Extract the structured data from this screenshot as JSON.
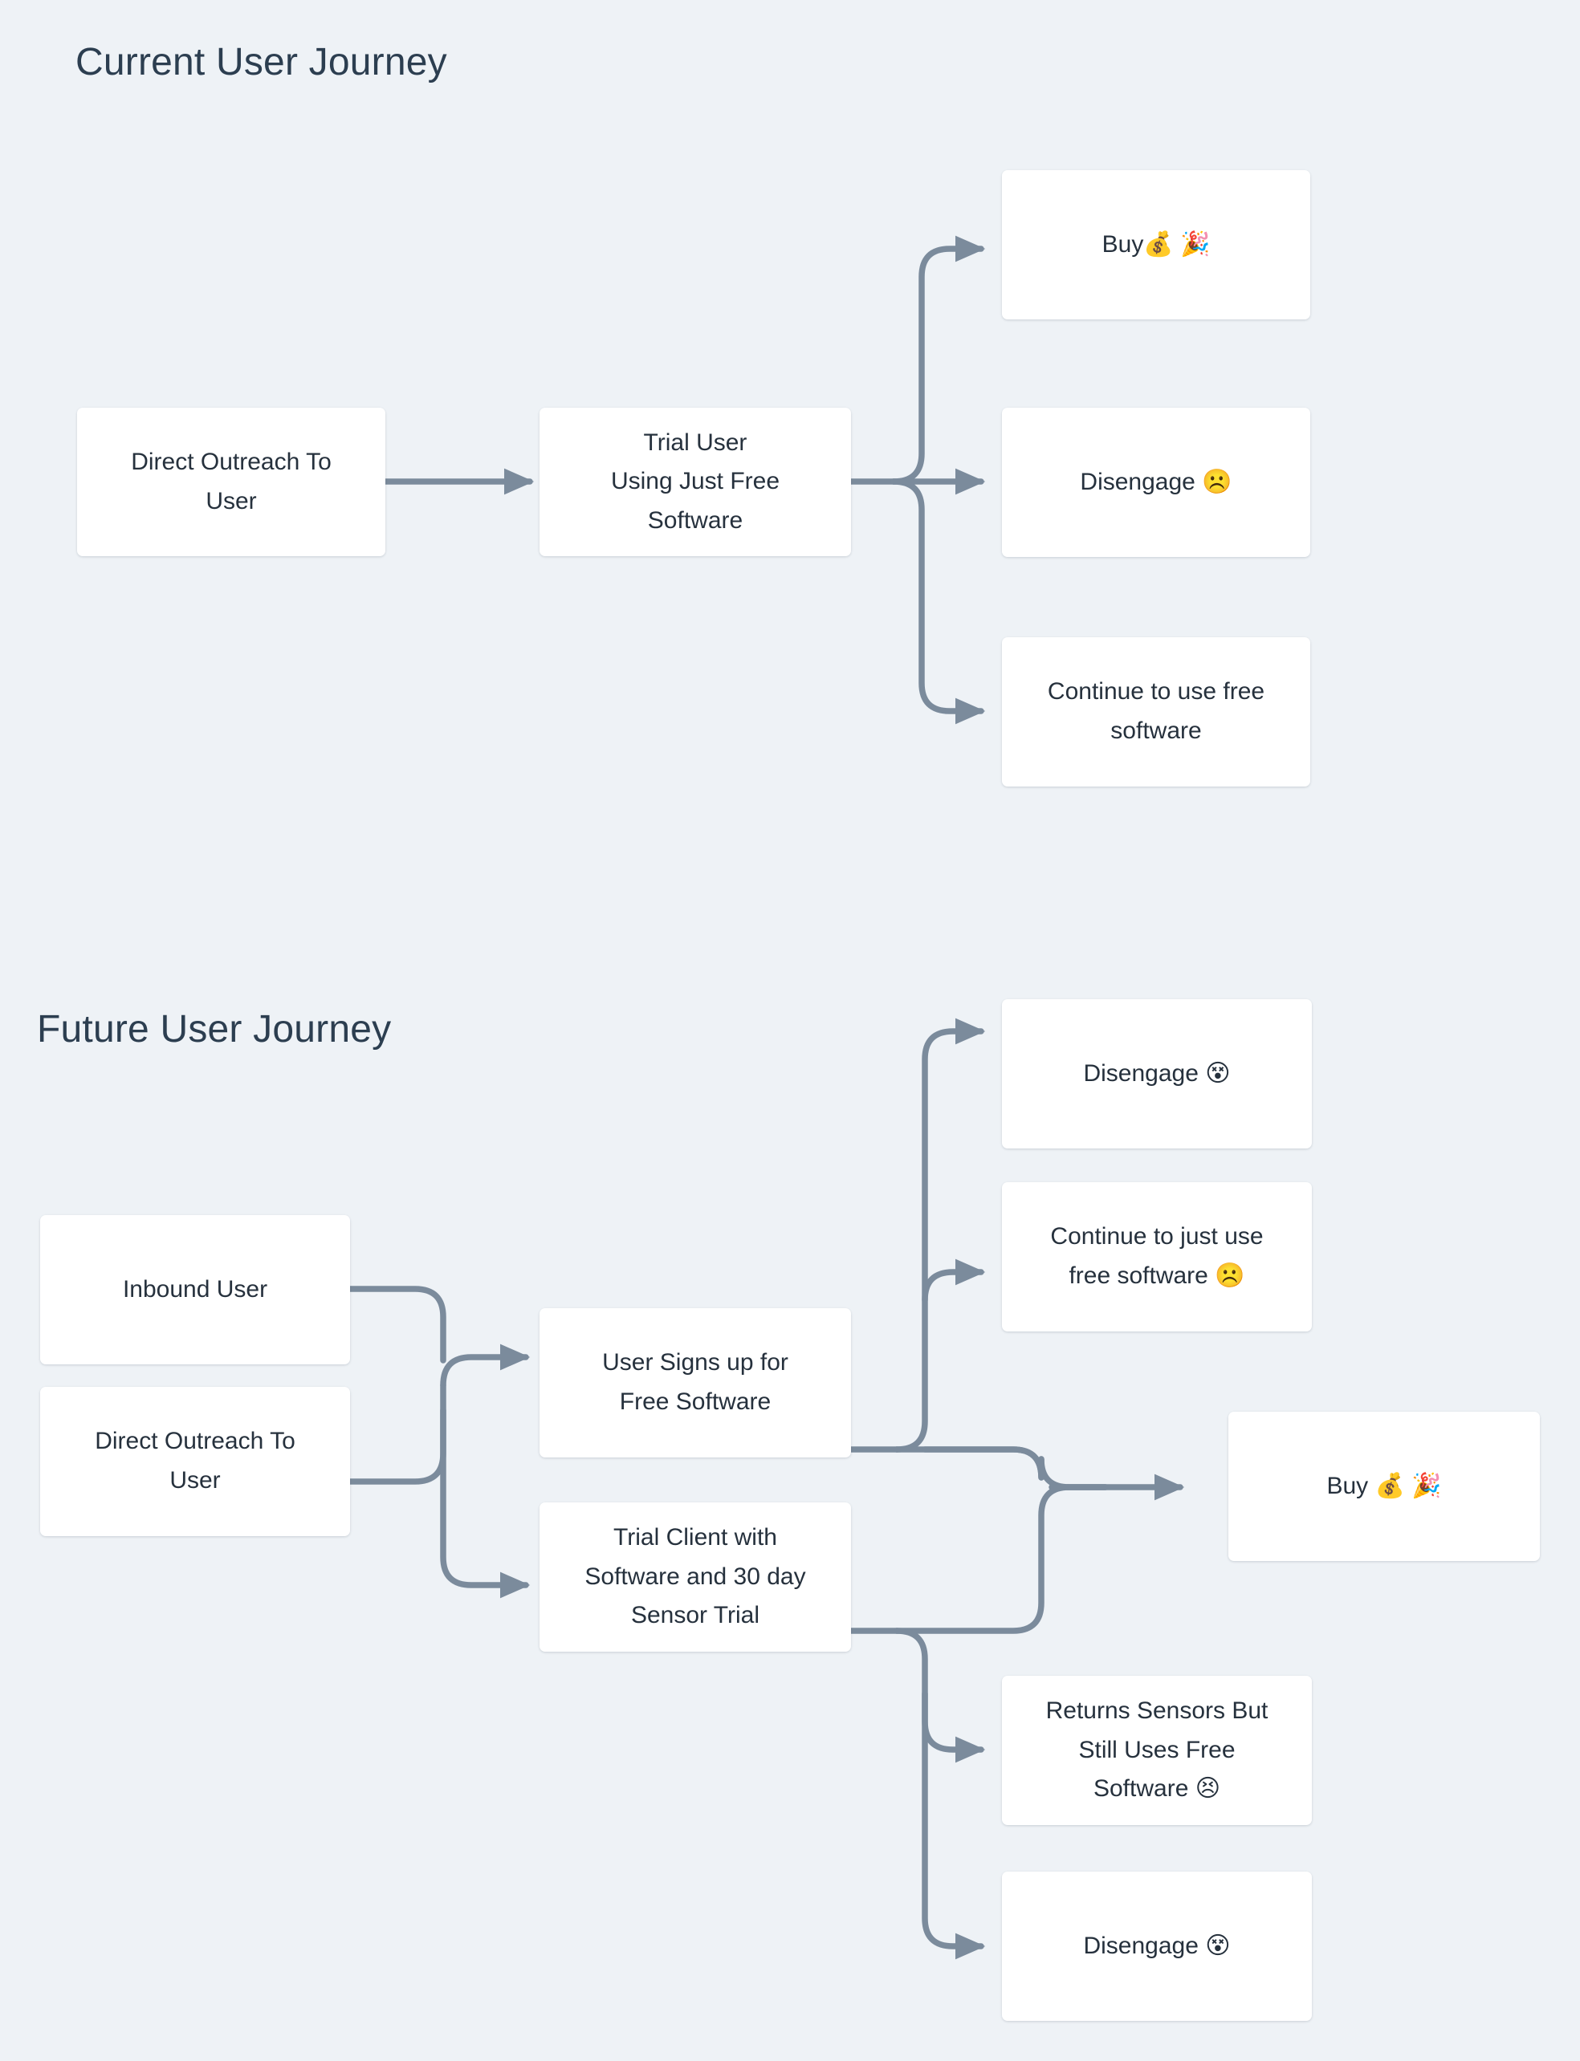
{
  "page": {
    "background_color": "#eef2f6",
    "node_fill_color": "#ffffff",
    "node_text_color": "#26313d",
    "title_color": "#2c3e50",
    "connector_color": "#7b8b9c"
  },
  "sections": [
    {
      "id": "current",
      "title": "Current User Journey",
      "nodes": [
        {
          "id": "c1",
          "label": "Direct Outreach To\nUser"
        },
        {
          "id": "c2",
          "label": "Trial User\nUsing Just Free\nSoftware"
        },
        {
          "id": "c3",
          "label": "Buy💰 🎉"
        },
        {
          "id": "c4",
          "label": "Disengage ☹️"
        },
        {
          "id": "c5",
          "label": "Continue to use free\nsoftware"
        }
      ],
      "edges": [
        {
          "from": "c1",
          "to": "c2"
        },
        {
          "from": "c2",
          "to": "c3"
        },
        {
          "from": "c2",
          "to": "c4"
        },
        {
          "from": "c2",
          "to": "c5"
        }
      ]
    },
    {
      "id": "future",
      "title": "Future User Journey",
      "nodes": [
        {
          "id": "f1",
          "label": "Inbound User"
        },
        {
          "id": "f2",
          "label": "Direct Outreach To\nUser"
        },
        {
          "id": "f3",
          "label": "User Signs up for\nFree Software"
        },
        {
          "id": "f4",
          "label": "Trial Client with\nSoftware and 30 day\nSensor Trial"
        },
        {
          "id": "f5",
          "label": "Disengage 😵"
        },
        {
          "id": "f6",
          "label": "Continue to just use\nfree software ☹️"
        },
        {
          "id": "f7",
          "label": "Buy 💰 🎉"
        },
        {
          "id": "f8",
          "label": "Returns Sensors But\nStill Uses Free\nSoftware 😣"
        },
        {
          "id": "f9",
          "label": "Disengage 😵"
        }
      ],
      "edges": [
        {
          "from": "f1",
          "to": "f3"
        },
        {
          "from": "f1",
          "to": "f4"
        },
        {
          "from": "f2",
          "to": "f3"
        },
        {
          "from": "f2",
          "to": "f4"
        },
        {
          "from": "f3",
          "to": "f5"
        },
        {
          "from": "f3",
          "to": "f6"
        },
        {
          "from": "f3",
          "to": "f7"
        },
        {
          "from": "f4",
          "to": "f7"
        },
        {
          "from": "f4",
          "to": "f8"
        },
        {
          "from": "f4",
          "to": "f9"
        }
      ]
    }
  ]
}
